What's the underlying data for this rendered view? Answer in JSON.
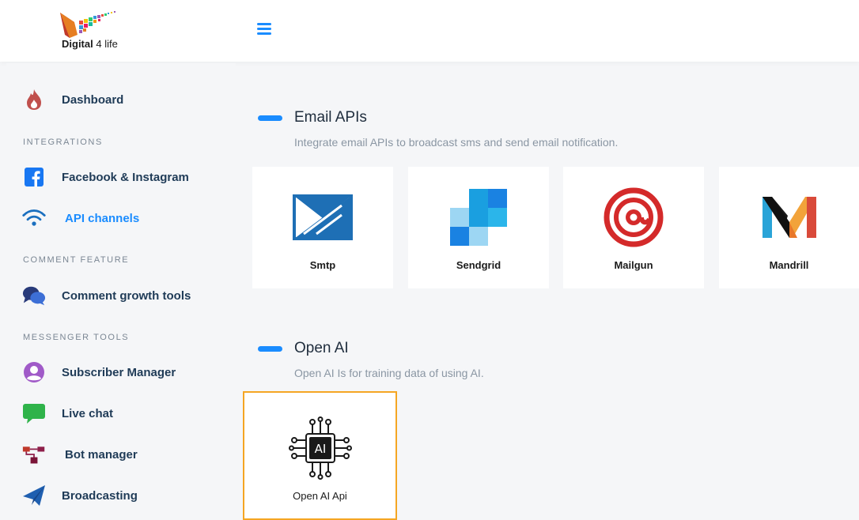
{
  "header": {
    "logo_brand": "Digital",
    "logo_suffix": "4 life"
  },
  "sidebar": {
    "items": [
      {
        "label": "Dashboard",
        "icon": "flame-icon"
      },
      {
        "label": "Facebook & Instagram",
        "icon": "facebook-icon"
      },
      {
        "label": "API channels",
        "icon": "wifi-icon",
        "active": true
      },
      {
        "label": "Comment growth tools",
        "icon": "chat-bubbles-icon"
      },
      {
        "label": "Subscriber Manager",
        "icon": "user-circle-icon"
      },
      {
        "label": "Live chat",
        "icon": "message-icon"
      },
      {
        "label": "Bot manager",
        "icon": "flow-icon"
      },
      {
        "label": "Broadcasting",
        "icon": "paper-plane-icon"
      }
    ],
    "sections": [
      "INTEGRATIONS",
      "COMMENT FEATURE",
      "MESSENGER TOOLS"
    ]
  },
  "main": {
    "email": {
      "title": "Email APIs",
      "description": "Integrate email APIs to broadcast sms and send email notification.",
      "cards": [
        {
          "label": "Smtp",
          "icon": "smtp-icon"
        },
        {
          "label": "Sendgrid",
          "icon": "sendgrid-icon"
        },
        {
          "label": "Mailgun",
          "icon": "mailgun-icon"
        },
        {
          "label": "Mandrill",
          "icon": "mandrill-icon"
        }
      ]
    },
    "openai": {
      "title": "Open AI",
      "description": "Open AI Is for training data of using AI.",
      "cards": [
        {
          "label": "Open AI Api",
          "icon": "ai-chip-icon",
          "chip_text": "AI"
        }
      ]
    }
  },
  "colors": {
    "accent": "#1a8cff",
    "selected_border": "#f5a623",
    "nav_text": "#1f3b57"
  }
}
